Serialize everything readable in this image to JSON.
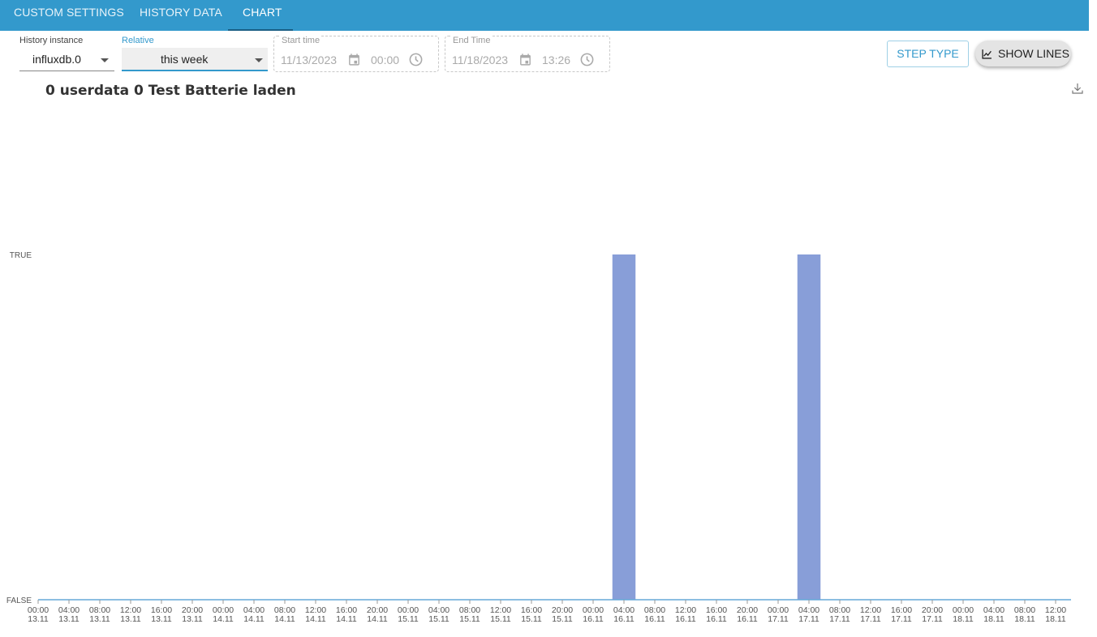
{
  "tabs": [
    {
      "label": "Custom settings"
    },
    {
      "label": "History data"
    },
    {
      "label": "Chart"
    }
  ],
  "history_instance": {
    "label": "History instance",
    "value": "influxdb.0"
  },
  "relative": {
    "label": "Relative",
    "value": "this week"
  },
  "start_time": {
    "label": "Start time",
    "date": "11/13/2023",
    "time": "00:00"
  },
  "end_time": {
    "label": "End Time",
    "date": "11/18/2023",
    "time": "13:26"
  },
  "buttons": {
    "step_type": "Step type",
    "show_lines": "Show lines"
  },
  "icons": {
    "calendar": "calendar-icon",
    "clock": "clock-icon",
    "show_lines": "line-chart-icon",
    "download": "download-icon",
    "dropdown": "chevron-down-icon"
  },
  "colors": {
    "header": "#3399cc",
    "bar": "#889ed8",
    "axis_line": "#66a8d8"
  },
  "chart_data": {
    "type": "bar",
    "title": "0 userdata 0 Test Batterie laden",
    "y_categories": [
      "FALSE",
      "TRUE"
    ],
    "x_ticks": [
      [
        "00:00",
        "13.11"
      ],
      [
        "04:00",
        "13.11"
      ],
      [
        "08:00",
        "13.11"
      ],
      [
        "12:00",
        "13.11"
      ],
      [
        "16:00",
        "13.11"
      ],
      [
        "20:00",
        "13.11"
      ],
      [
        "00:00",
        "14.11"
      ],
      [
        "04:00",
        "14.11"
      ],
      [
        "08:00",
        "14.11"
      ],
      [
        "12:00",
        "14.11"
      ],
      [
        "16:00",
        "14.11"
      ],
      [
        "20:00",
        "14.11"
      ],
      [
        "00:00",
        "15.11"
      ],
      [
        "04:00",
        "15.11"
      ],
      [
        "08:00",
        "15.11"
      ],
      [
        "12:00",
        "15.11"
      ],
      [
        "16:00",
        "15.11"
      ],
      [
        "20:00",
        "15.11"
      ],
      [
        "00:00",
        "16.11"
      ],
      [
        "04:00",
        "16.11"
      ],
      [
        "08:00",
        "16.11"
      ],
      [
        "12:00",
        "16.11"
      ],
      [
        "16:00",
        "16.11"
      ],
      [
        "20:00",
        "16.11"
      ],
      [
        "00:00",
        "17.11"
      ],
      [
        "04:00",
        "17.11"
      ],
      [
        "08:00",
        "17.11"
      ],
      [
        "12:00",
        "17.11"
      ],
      [
        "16:00",
        "17.11"
      ],
      [
        "20:00",
        "17.11"
      ],
      [
        "00:00",
        "18.11"
      ],
      [
        "04:00",
        "18.11"
      ],
      [
        "08:00",
        "18.11"
      ],
      [
        "12:00",
        "18.11"
      ]
    ],
    "x_range_hours": [
      0,
      134
    ],
    "series": [
      {
        "segments": [
          {
            "start_hour": 74.5,
            "end_hour": 77.5,
            "value": "TRUE"
          },
          {
            "start_hour": 98.5,
            "end_hour": 101.5,
            "value": "TRUE"
          }
        ]
      }
    ]
  }
}
